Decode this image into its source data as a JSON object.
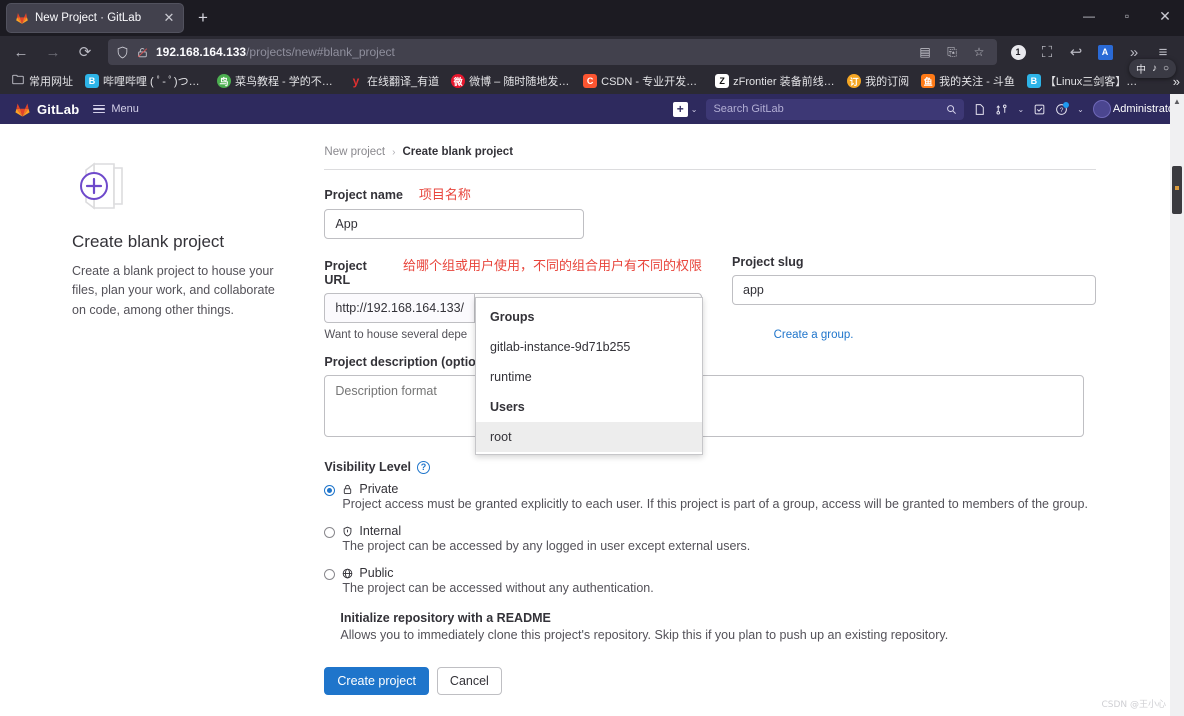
{
  "browser": {
    "tab": {
      "title": "New Project · GitLab",
      "favicon": "gitlab-favicon",
      "close": "✕"
    },
    "new_tab": "+",
    "window_controls": {
      "minimize": "—",
      "maximize": "▫",
      "close": "✕"
    },
    "nav": {
      "back": "←",
      "forward": "→",
      "reload": "⟳"
    },
    "url": {
      "host": "192.168.164.133",
      "path": "/projects/new#blank_project"
    },
    "url_icons": {
      "shield": "shield-icon",
      "lock_broken": "broken-lock-icon"
    },
    "url_right_icons": [
      "qr-code-icon",
      "translate-icon",
      "bookmark-star-icon"
    ],
    "toolbar_icons": [
      "badge-1",
      "crop-icon",
      "undo-icon",
      "translate-ext-icon",
      "overflow-chevron",
      "app-menu-icon"
    ],
    "toolbar_badge": "1",
    "ime_popup": [
      "中",
      "♪",
      "○"
    ],
    "bookmarks": [
      {
        "label": "常用网址",
        "icon": "folder-icon",
        "color": "none"
      },
      {
        "label": "哔哩哔哩 ( ﾟ- ﾟ)つロ ...",
        "icon": "bilibili-icon",
        "color": "#2db4e8"
      },
      {
        "label": "菜鸟教程 - 学的不仅...",
        "icon": "runoob-icon",
        "color": "#4caf50"
      },
      {
        "label": "在线翻译_有道",
        "icon": "youdao-icon",
        "color": "#e03030"
      },
      {
        "label": "微博 – 随时随地发现...",
        "icon": "weibo-icon",
        "color": "#e6162d"
      },
      {
        "label": "CSDN - 专业开发者社...",
        "icon": "csdn-icon",
        "color": "#fc5531"
      },
      {
        "label": "zFrontier 装备前线 - ...",
        "icon": "zfrontier-icon",
        "color": "#ffffff"
      },
      {
        "label": "我的订阅",
        "icon": "subscribe-icon",
        "color": "#f5a623"
      },
      {
        "label": "我的关注 - 斗鱼",
        "icon": "douyu-icon",
        "color": "#ff7a16"
      },
      {
        "label": "【Linux三剑客】下架...",
        "icon": "bilibili-icon",
        "color": "#2db4e8"
      }
    ],
    "bookmarks_overflow": "»"
  },
  "gitlab_header": {
    "brand": "GitLab",
    "menu_label": "Menu",
    "plus_label": "+",
    "search_placeholder": "Search GitLab",
    "search_value": "",
    "icons": [
      "issues-icon",
      "merge-requests-icon",
      "todos-icon",
      "help-icon"
    ],
    "user_name": "Administrato",
    "caret": "⌄"
  },
  "left_panel": {
    "title": "Create blank project",
    "description": "Create a blank project to house your files, plan your work, and collaborate on code, among other things.",
    "icon": "blank-project-plus-icon"
  },
  "breadcrumb": {
    "parent": "New project",
    "separator": "›",
    "current": "Create blank project"
  },
  "form": {
    "project_name": {
      "label": "Project name",
      "annotation": "项目名称",
      "value": "App",
      "placeholder": ""
    },
    "project_url": {
      "label": "Project URL",
      "annotation": "给哪个组或用户使用，不同的组合用户有不同的权限",
      "prefix": "http://192.168.164.133/",
      "selected": "root",
      "caret": "⌄"
    },
    "project_slug": {
      "label": "Project slug",
      "value": "app"
    },
    "helper": {
      "text_before": "Want to house several depe",
      "link": "Create a group."
    },
    "project_description": {
      "label": "Project description (optional)",
      "placeholder": "Description format",
      "value": ""
    },
    "visibility": {
      "label": "Visibility Level",
      "help_icon": "?",
      "options": [
        {
          "name": "Private",
          "icon": "lock-icon",
          "selected": true,
          "description": "Project access must be granted explicitly to each user. If this project is part of a group, access will be granted to members of the group."
        },
        {
          "name": "Internal",
          "icon": "shield-icon",
          "selected": false,
          "description": "The project can be accessed by any logged in user except external users."
        },
        {
          "name": "Public",
          "icon": "globe-icon",
          "selected": false,
          "description": "The project can be accessed without any authentication."
        }
      ]
    },
    "readme": {
      "title": "Initialize repository with a README",
      "description": "Allows you to immediately clone this project's repository. Skip this if you plan to push up an existing repository."
    },
    "buttons": {
      "primary": "Create project",
      "secondary": "Cancel"
    }
  },
  "dropdown": {
    "items": [
      {
        "label": "Groups",
        "type": "header",
        "selected": false
      },
      {
        "label": "gitlab-instance-9d71b255",
        "type": "option",
        "selected": false
      },
      {
        "label": "runtime",
        "type": "option",
        "selected": false
      },
      {
        "label": "Users",
        "type": "header",
        "selected": false
      },
      {
        "label": "root",
        "type": "option",
        "selected": true
      }
    ]
  },
  "scrollbar": {
    "up": "▲",
    "down": "▼"
  },
  "watermark": "CSDN @王小心"
}
